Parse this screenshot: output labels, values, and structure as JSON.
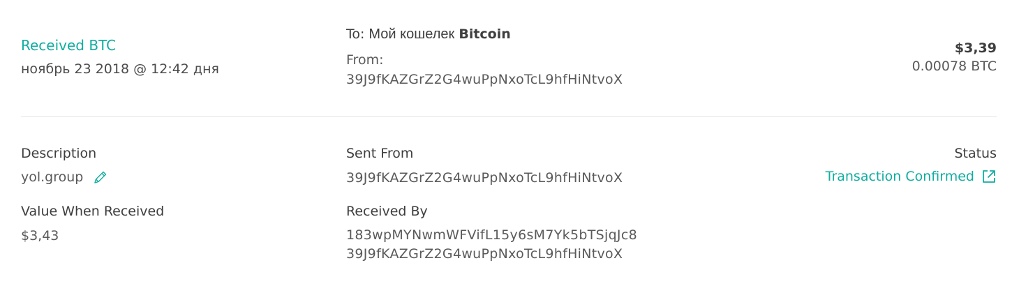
{
  "summary": {
    "type_label": "Received BTC",
    "date": "ноябрь 23 2018 @ 12:42 дня",
    "to_label": "To:",
    "to_wallet_name": "Мой кошелек",
    "to_wallet_currency": "Bitcoin",
    "from_label": "From:",
    "from_address": "39J9fKAZGrZ2G4wuPpNxoTcL9hfHiNtvoX",
    "fiat_amount": "$3,39",
    "crypto_amount": "0.00078 BTC"
  },
  "details": {
    "description_label": "Description",
    "description_value": "yol.group",
    "value_when_received_label": "Value When Received",
    "value_when_received": "$3,43",
    "sent_from_label": "Sent From",
    "sent_from_address": "39J9fKAZGrZ2G4wuPpNxoTcL9hfHiNtvoX",
    "received_by_label": "Received By",
    "received_by_addresses": [
      "183wpMYNwmWFVifL15y6sM7Yk5bTSjqJc8",
      "39J9fKAZGrZ2G4wuPpNxoTcL9hfHiNtvoX"
    ],
    "status_label": "Status",
    "status_value": "Transaction Confirmed"
  },
  "icons": {
    "edit": "pencil-icon",
    "external_link": "external-link-icon"
  },
  "colors": {
    "accent": "#10ada0",
    "text_primary": "#3e3e3e",
    "text_secondary": "#5a5a5a",
    "divider": "#e3e3e3"
  }
}
